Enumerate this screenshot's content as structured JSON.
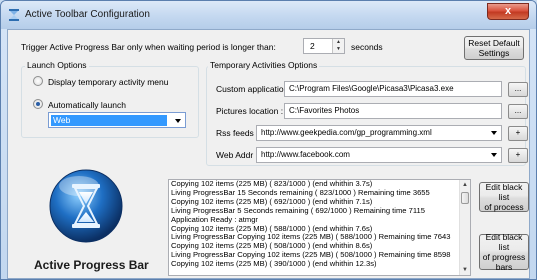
{
  "window": {
    "title": "Active Toolbar Configuration",
    "close_glyph": "x"
  },
  "trigger": {
    "label": "Trigger Active Progress Bar only when waiting period is longer than:",
    "value": "2",
    "unit": "seconds"
  },
  "reset_button": {
    "line1": "Reset Default",
    "line2": "Settings"
  },
  "launch_options": {
    "title": "Launch Options",
    "radio_display": "Display temporary activity menu",
    "radio_auto": "Automatically launch",
    "selected_value": "Web",
    "selected_radio": "auto"
  },
  "temp_activities": {
    "title": "Temporary Activities Options",
    "custom_app_label": "Custom application :",
    "custom_app_value": "C:\\Program Files\\Google\\Picasa3\\Picasa3.exe",
    "pictures_label": "Pictures location :",
    "pictures_value": "C:\\Favorites Photos",
    "rss_label": "Rss feeds :",
    "rss_value": "http://www.geekpedia.com/gp_programming.xml",
    "web_label": "Web Addr :",
    "web_value": "http://www.facebook.com",
    "browse_label": "...",
    "add_label": "+"
  },
  "log": {
    "lines": [
      "Copying 102 items (225 MB) ( 823/1000 ) (end whithin 3.7s)",
      "Living ProgressBar 15 Seconds remaining ( 823/1000 ) Remaining time 3655",
      "Copying 102 items (225 MB) ( 692/1000 ) (end whithin 7.1s)",
      "Living ProgressBar 5 Seconds remaining ( 692/1000 ) Remaining time 7115",
      "Application Ready : atmgr",
      "Copying 102 items (225 MB) ( 588/1000 ) (end whithin 7.6s)",
      "Living ProgressBar Copying 102 items (225 MB) ( 588/1000 ) Remaining time 7643",
      "Copying 102 items (225 MB) ( 508/1000 ) (end whithin 8.6s)",
      "Living ProgressBar Copying 102 items (225 MB) ( 508/1000 ) Remaining time 8598",
      "Copying 102 items (225 MB) ( 390/1000 ) (end whithin 12.3s)"
    ]
  },
  "black_list": {
    "process_line1": "Edit black list",
    "process_line2": "of process",
    "bars_line1": "Edit black list",
    "bars_line2": "of progress",
    "bars_line3": "bars"
  },
  "branding": {
    "name": "Active Progress Bar"
  },
  "colors": {
    "titlebar": "#c4d8f0",
    "selection": "#3399ff",
    "close": "#d9533e"
  },
  "icons": {
    "app": "hourglass-icon",
    "logo": "hourglass-logo"
  }
}
